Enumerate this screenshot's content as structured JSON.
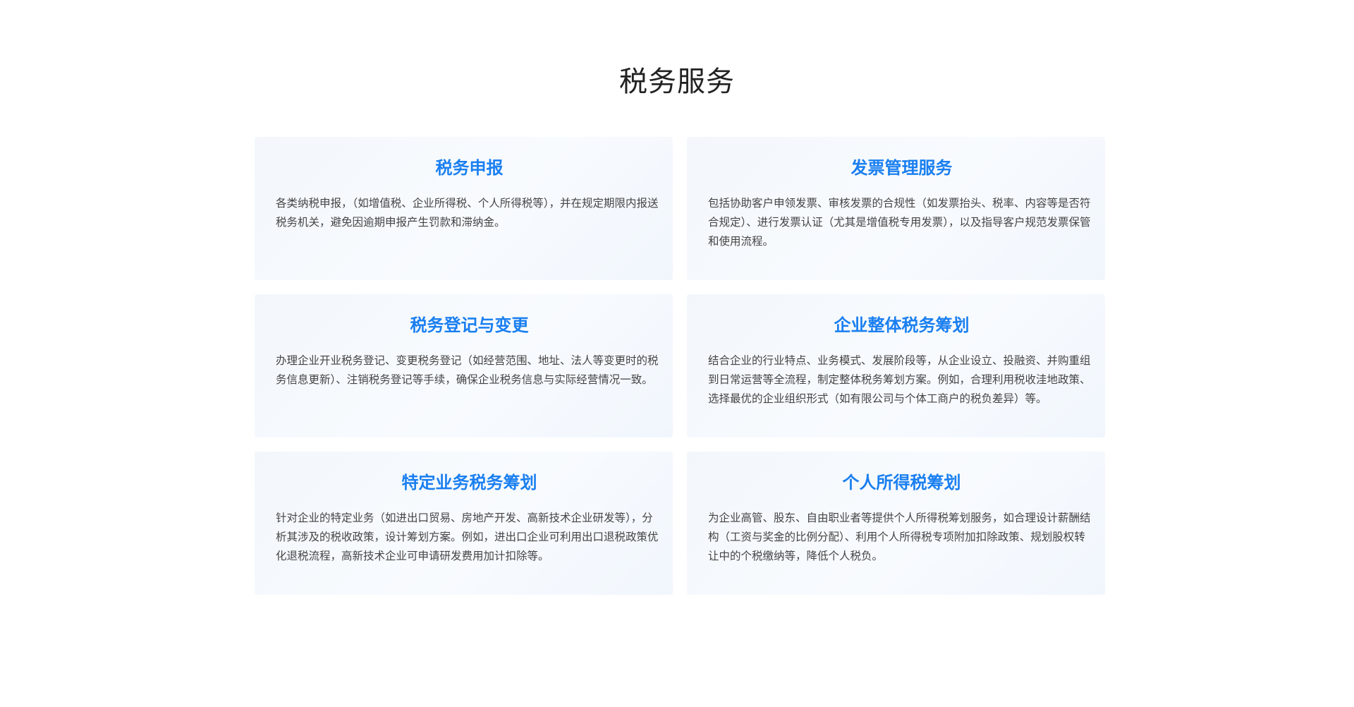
{
  "section": {
    "title": "税务服务"
  },
  "services": [
    {
      "title": "税务申报",
      "description": "各类纳税申报，（如增值税、企业所得税、个人所得税等），并在规定期限内报送税务机关，避免因逾期申报产生罚款和滞纳金。"
    },
    {
      "title": "发票管理服务",
      "description": "包括协助客户申领发票、审核发票的合规性（如发票抬头、税率、内容等是否符合规定）、进行发票认证（尤其是增值税专用发票），以及指导客户规范发票保管和使用流程。"
    },
    {
      "title": "税务登记与变更",
      "description": "办理企业开业税务登记、变更税务登记（如经营范围、地址、法人等变更时的税务信息更新）、注销税务登记等手续，确保企业税务信息与实际经营情况一致。"
    },
    {
      "title": "企业整体税务筹划",
      "description": "结合企业的行业特点、业务模式、发展阶段等，从企业设立、投融资、并购重组到日常运营等全流程，制定整体税务筹划方案。例如，合理利用税收洼地政策、选择最优的企业组织形式（如有限公司与个体工商户的税负差异）等。"
    },
    {
      "title": "特定业务税务筹划",
      "description": "针对企业的特定业务（如进出口贸易、房地产开发、高新技术企业研发等），分析其涉及的税收政策，设计筹划方案。例如，进出口企业可利用出口退税政策优化退税流程，高新技术企业可申请研发费用加计扣除等。"
    },
    {
      "title": "个人所得税筹划",
      "description": "为企业高管、股东、自由职业者等提供个人所得税筹划服务，如合理设计薪酬结构（工资与奖金的比例分配）、利用个人所得税专项附加扣除政策、规划股权转让中的个税缴纳等，降低个人税负。"
    }
  ],
  "colors": {
    "card_title": "#1a7ff0",
    "section_title": "#222222",
    "body_text": "#444444",
    "card_background": "#f5f9fd"
  }
}
